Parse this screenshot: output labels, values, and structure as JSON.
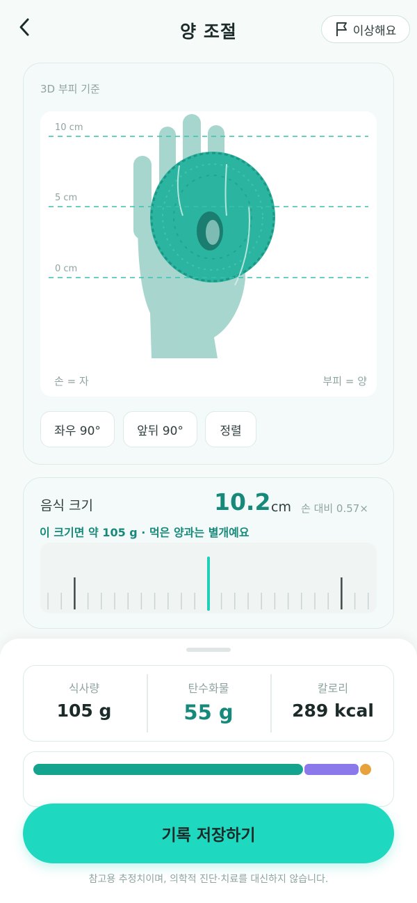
{
  "header": {
    "title": "양 조절",
    "report_label": "이상해요"
  },
  "viewer": {
    "basis_label": "3D 부피 기준",
    "grid_labels": [
      "10 cm",
      "5 cm",
      "0 cm"
    ],
    "legend_left": "손 = 자",
    "legend_right": "부피 = 양",
    "buttons": [
      "좌우 90°",
      "앞뒤 90°",
      "정렬"
    ]
  },
  "size": {
    "label": "음식 크기",
    "value": "10.2",
    "unit": "cm",
    "ratio": "손 대비 0.57×",
    "hint": "이 크기면 약 105 g · 먹은 양과는 별개예요"
  },
  "stats": [
    {
      "label": "식사량",
      "value": "105 g"
    },
    {
      "label": "탄수화물",
      "value": "55 g"
    },
    {
      "label": "칼로리",
      "value": "289 kcal"
    }
  ],
  "macro_bar": {
    "colors": {
      "carb": "#14a48e",
      "protein": "#8b78ea",
      "fat": "#e6a23c"
    }
  },
  "actions": {
    "save_label": "기록 저장하기"
  },
  "footer": {
    "disclaimer": "참고용 추정치이며, 의학적 진단·치료를 대신하지 않습니다."
  },
  "theme": {
    "accent": "#17897a",
    "button": "#1ed8bf"
  }
}
